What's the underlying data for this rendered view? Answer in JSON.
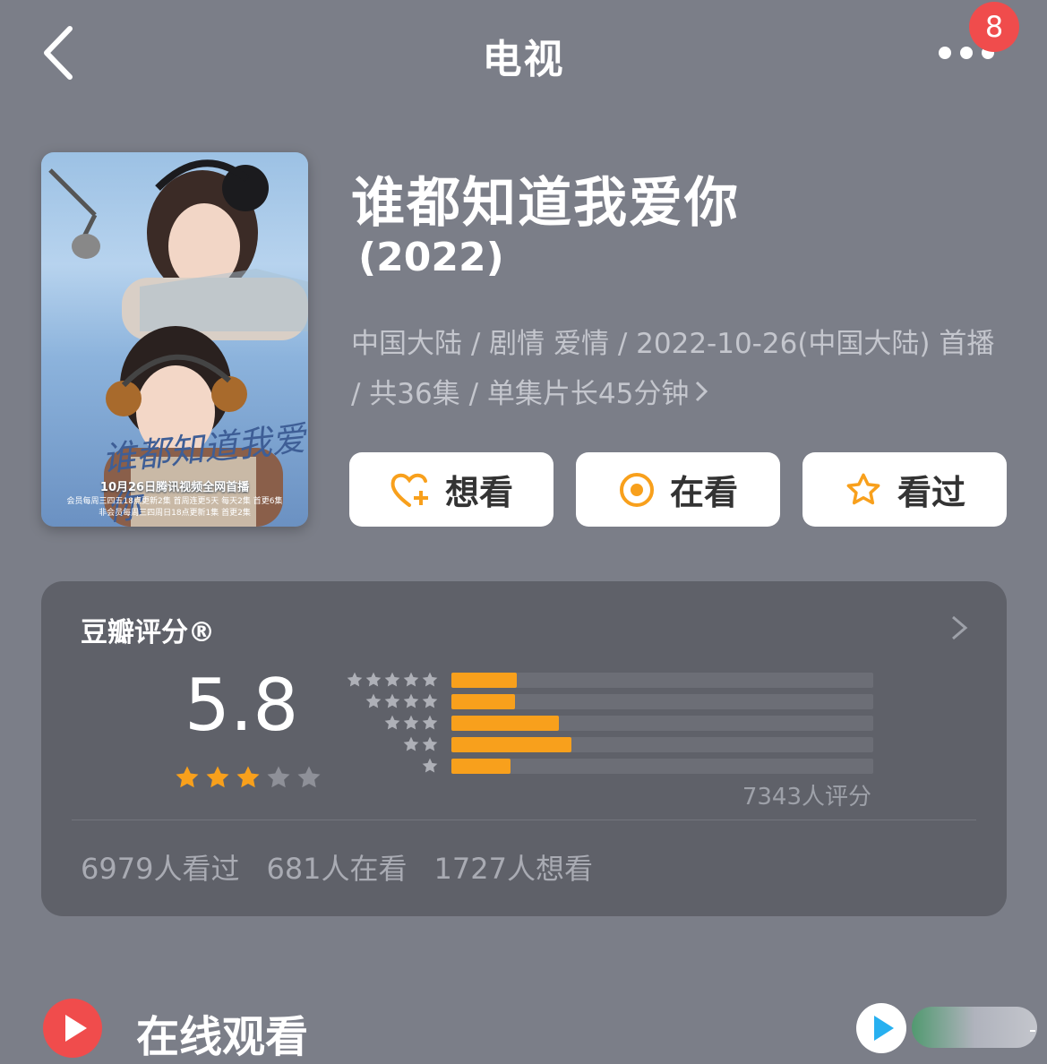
{
  "header": {
    "title": "电视",
    "badge_count": "8"
  },
  "poster": {
    "calligraphy": "谁都知道我爱你",
    "caption_line1": "10月26日腾讯视频全网首播",
    "caption_line2": "会员每周三四五18点更新2集 首周连更5天 每天2集 首更6集",
    "caption_line3": "非会员每周三四周日18点更新1集 首更2集"
  },
  "drama": {
    "title": "谁都知道我爱你",
    "year": "(2022)",
    "meta": "中国大陆 / 剧情 爱情 / 2022-10-26(中国大陆) 首播 / 共36集 / 单集片长45分钟"
  },
  "actions": {
    "want_label": "想看",
    "watching_label": "在看",
    "watched_label": "看过"
  },
  "rating": {
    "title": "豆瓣评分®",
    "score": "5.8",
    "stars_filled": 3,
    "stars_total": 5,
    "distribution": [
      {
        "stars": 5,
        "fraction": 0.155
      },
      {
        "stars": 4,
        "fraction": 0.15
      },
      {
        "stars": 3,
        "fraction": 0.255
      },
      {
        "stars": 2,
        "fraction": 0.285
      },
      {
        "stars": 1,
        "fraction": 0.14
      }
    ],
    "count_label": "7343人评分",
    "stats": [
      "6979人看过",
      "681人在看",
      "1727人想看"
    ]
  },
  "online": {
    "label": "在线观看"
  },
  "colors": {
    "background": "#7b7e88",
    "panel": "#5f6169",
    "accent": "#f8a01c",
    "badge": "#f04c4c"
  }
}
